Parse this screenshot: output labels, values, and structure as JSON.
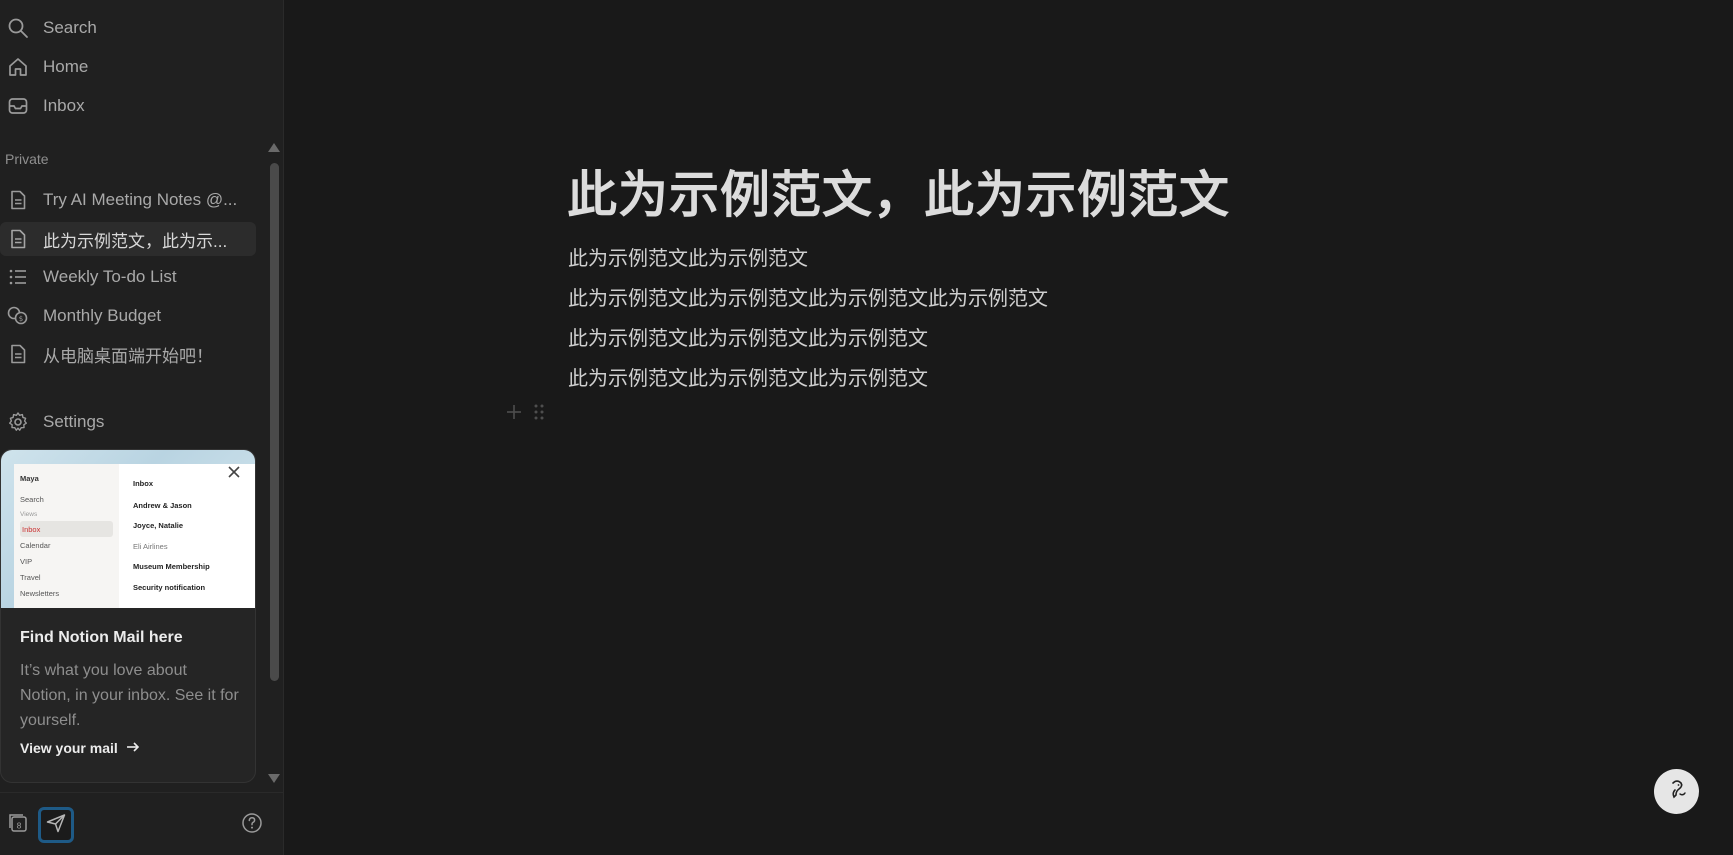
{
  "sidebar": {
    "top_items": [
      {
        "label": "Search",
        "icon": "search-icon"
      },
      {
        "label": "Home",
        "icon": "home-icon"
      },
      {
        "label": "Inbox",
        "icon": "inbox-icon"
      }
    ],
    "section_label": "Private",
    "pages": [
      {
        "label": "Try AI Meeting Notes @...",
        "icon": "page-icon"
      },
      {
        "label": "此为示例范文，此为示...",
        "icon": "page-icon",
        "active": true
      },
      {
        "label": "Weekly To-do List",
        "icon": "list-icon"
      },
      {
        "label": "Monthly Budget",
        "icon": "coins-icon"
      },
      {
        "label": "从电脑桌面端开始吧！",
        "icon": "page-icon"
      }
    ],
    "settings_label": "Settings"
  },
  "mail_card": {
    "preview": {
      "user": "Maya",
      "search": "Search",
      "views_label": "Views",
      "views": [
        "Inbox",
        "Calendar",
        "VIP",
        "Travel",
        "Newsletters"
      ],
      "header": "Inbox",
      "messages": [
        "Andrew & Jason",
        "Joyce, Natalie",
        "Eli Airlines",
        "Museum Membership",
        "Security notification"
      ]
    },
    "title": "Find Notion Mail here",
    "body": "It’s what you love about Notion, in your inbox. See it for yourself.",
    "link": "View your mail"
  },
  "page": {
    "title": "此为示例范文，此为示例范文",
    "paragraphs": [
      "此为示例范文此为示例范文",
      "此为示例范文此为示例范文此为示例范文此为示例范文",
      "此为示例范文此为示例范文此为示例范文",
      "此为示例范文此为示例范文此为示例范文"
    ]
  },
  "colors": {
    "background": "#191919",
    "sidebar": "#202020",
    "active_item": "#2c2c2c",
    "accent_border": "#1e5a86"
  }
}
